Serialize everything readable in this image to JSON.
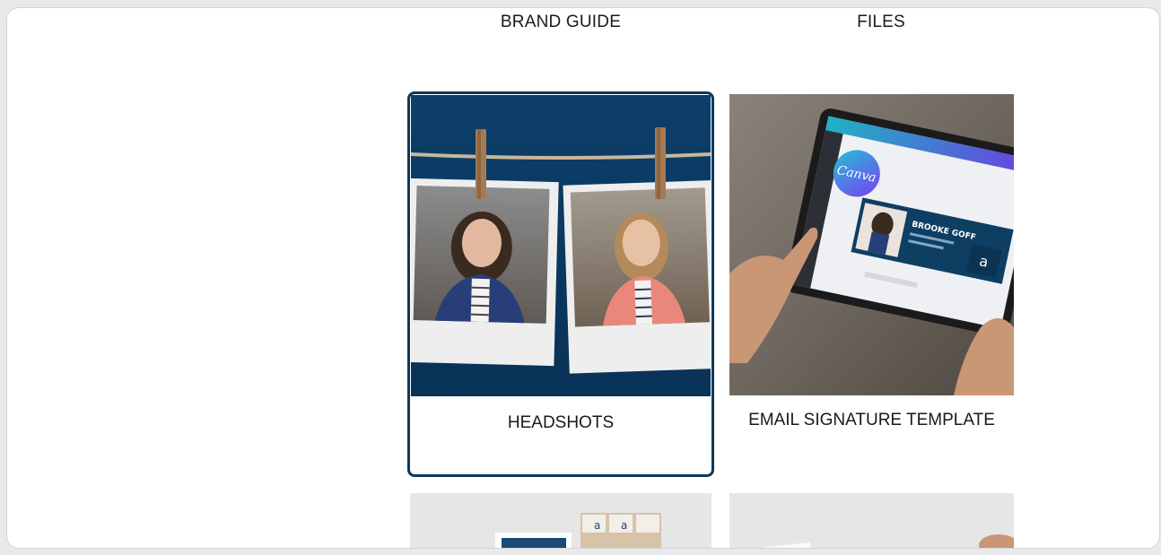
{
  "grid": {
    "top_labels": [
      "BRAND GUIDE",
      "FILES"
    ],
    "cards": [
      {
        "label": "HEADSHOTS",
        "selected": true
      },
      {
        "label": "EMAIL SIGNATURE TEMPLATE",
        "selected": false
      }
    ]
  },
  "email_mockup": {
    "brand_logo": "Canva",
    "name": "BROOKE GOFF"
  },
  "colors": {
    "accent": "#0b3a5a",
    "headshot_bg": "#0c3b63"
  }
}
